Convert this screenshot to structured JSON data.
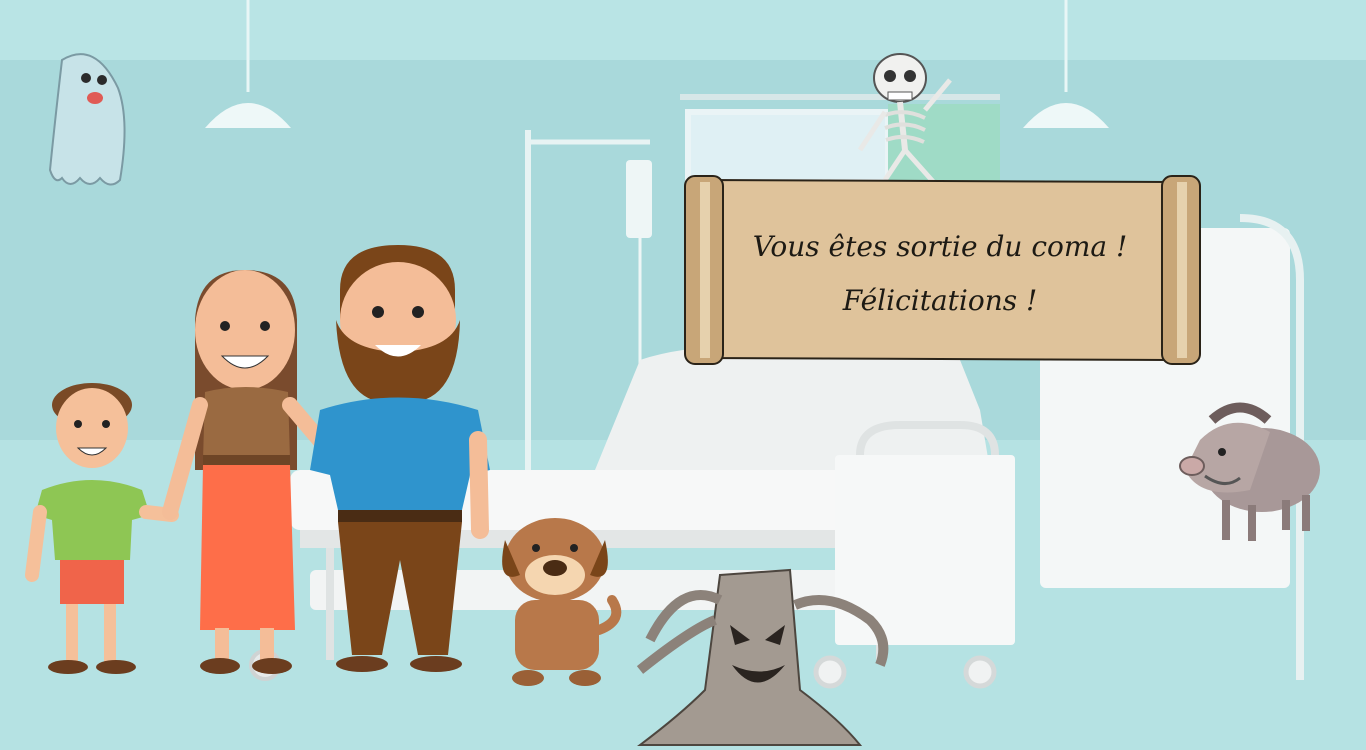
{
  "dialog": {
    "line1": "Vous êtes sortie du coma !",
    "line2": "Félicitations !"
  },
  "colors": {
    "background": "#b6e3e4",
    "floor": "#a9dcdd",
    "scroll": "#dfc39b",
    "scroll_edge": "#c09b6c"
  },
  "characters": [
    "ghost-icon",
    "skeleton-icon",
    "boar-icon",
    "tree-monster-icon",
    "boy",
    "mother",
    "father",
    "dog"
  ]
}
